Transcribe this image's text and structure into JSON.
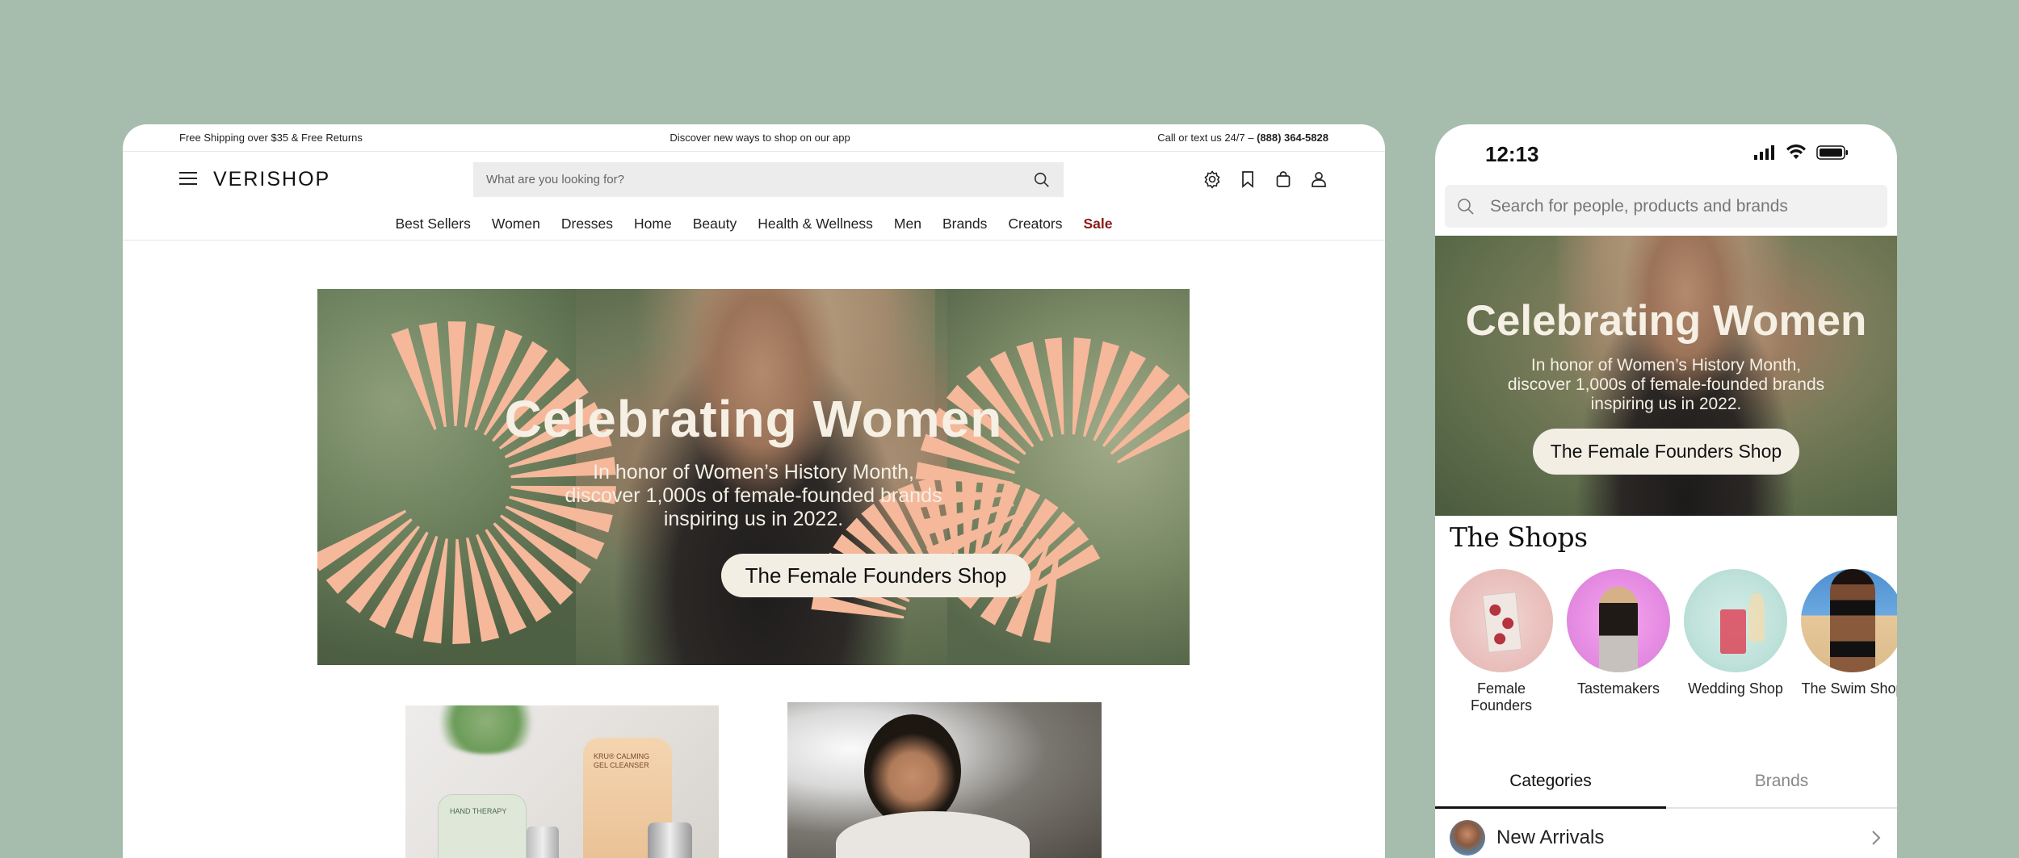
{
  "desktop": {
    "promo": {
      "left": "Free Shipping over $35 & Free Returns",
      "center": "Discover new ways to shop on our app",
      "right_prefix": "Call or text us 24/7 – ",
      "phone": "(888) 364-5828"
    },
    "logo": "VERISHOP",
    "search": {
      "placeholder": "What are you looking for?"
    },
    "header_icons": [
      "settings-icon",
      "bookmark-icon",
      "bag-icon",
      "user-icon"
    ],
    "nav": [
      "Best Sellers",
      "Women",
      "Dresses",
      "Home",
      "Beauty",
      "Health & Wellness",
      "Men",
      "Brands",
      "Creators",
      "Sale"
    ],
    "hero": {
      "title": "Celebrating Women",
      "sub1": "In honor of Women’s History Month,",
      "sub2": "discover 1,000s of female-founded brands",
      "sub3": "inspiring us in 2022.",
      "button": "The Female Founders Shop"
    },
    "product1": {
      "label_a": "HAND THERAPY",
      "label_b": "KRU® CALMING GEL CLEANSER"
    }
  },
  "mobile": {
    "time": "12:13",
    "search": {
      "placeholder": "Search for people, products and brands"
    },
    "hero": {
      "title": "Celebrating Women",
      "sub1": "In honor of Women’s History Month,",
      "sub2": "discover 1,000s of female-founded brands",
      "sub3": "inspiring us in 2022.",
      "button": "The Female Founders Shop"
    },
    "shops_title": "The Shops",
    "shops": [
      {
        "line1": "Female",
        "line2": "Founders"
      },
      {
        "line1": "Tastemakers",
        "line2": ""
      },
      {
        "line1": "Wedding Shop",
        "line2": ""
      },
      {
        "line1": "The Swim Shop",
        "line2": ""
      }
    ],
    "tabs": [
      "Categories",
      "Brands"
    ],
    "list_item": "New Arrivals"
  },
  "colors": {
    "background": "#a6bcac",
    "sale": "#8a1a1a",
    "ray": "#f5b89a",
    "button_bg": "#f3eee4"
  }
}
